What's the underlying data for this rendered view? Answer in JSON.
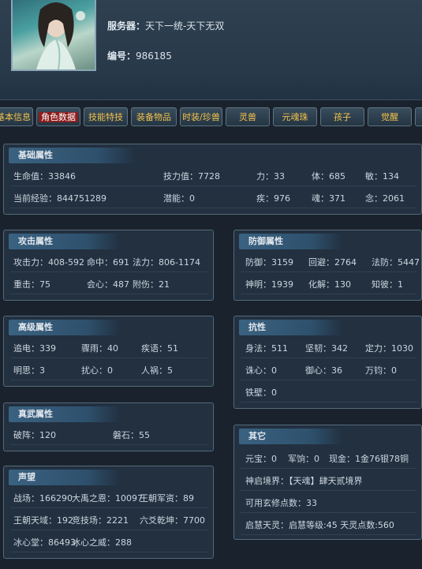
{
  "header": {
    "server_label": "服务器：",
    "server_value": "天下一统-天下无双",
    "id_label": "编号：",
    "id_value": "986185"
  },
  "tabs": [
    {
      "label": "基本信息"
    },
    {
      "label": "角色数据",
      "active": true
    },
    {
      "label": "技能特技"
    },
    {
      "label": "装备物品"
    },
    {
      "label": "时装/珍兽"
    },
    {
      "label": "灵兽"
    },
    {
      "label": "元魂珠"
    },
    {
      "label": "孩子"
    },
    {
      "label": "觉醒"
    }
  ],
  "basic": {
    "title": "基础属性",
    "hp": "生命值：33846",
    "skill": "技力值：7728",
    "str": "力：33",
    "con": "体：685",
    "agi": "敏：134",
    "exp": "当前经验：844751289",
    "potential": "潜能：0",
    "spd": "疾：976",
    "soul": "魂：371",
    "mind": "念：2061"
  },
  "attack": {
    "title": "攻击属性",
    "atk": "攻击力：408-592",
    "hit": "命中：691",
    "mag": "法力：806-1174",
    "heavy": "重击：75",
    "crit": "会心：487",
    "extra": "附伤：21"
  },
  "defense": {
    "title": "防御属性",
    "def": "防御：3159",
    "dodge": "回避：2764",
    "mdef": "法防：5447",
    "insight": "神明：1939",
    "resolve": "化解：130",
    "know": "知彼：1"
  },
  "advanced": {
    "title": "高级属性",
    "a1": "追电：339",
    "a2": "骤雨：40",
    "a3": "疾语：51",
    "a4": "明思：3",
    "a5": "扰心：0",
    "a6": "人祸：5"
  },
  "resist": {
    "title": "抗性",
    "r1": "身法：511",
    "r2": "坚韧：342",
    "r3": "定力：1030",
    "r4": "诛心：0",
    "r5": "御心：36",
    "r6": "万钧：0",
    "r7": "铁壁：0"
  },
  "zhenwu": {
    "title": "真武属性",
    "z1": "破阵：120",
    "z2": "磐石：55"
  },
  "other": {
    "title": "其它",
    "yuanbao": "元宝：0",
    "junxiang": "军饷：0",
    "cash": "现金：1金76银78铜",
    "shenqi": "神启境界：【天魂】肆天贰境界",
    "xuanxiu": "可用玄修点数：33",
    "qihui": "启慧天灵：启慧等级:45 天灵点数:560"
  },
  "fame": {
    "title": "声望",
    "f1": "战场：166290",
    "f2": "大禹之恩：10097",
    "f3": "王朝军资：89",
    "f4": "王朝天域：192",
    "f5": "竞技场：2221",
    "f6": "六爻乾坤：7700",
    "f7": "冰心堂：86493",
    "f8": "冰心之威：288"
  }
}
